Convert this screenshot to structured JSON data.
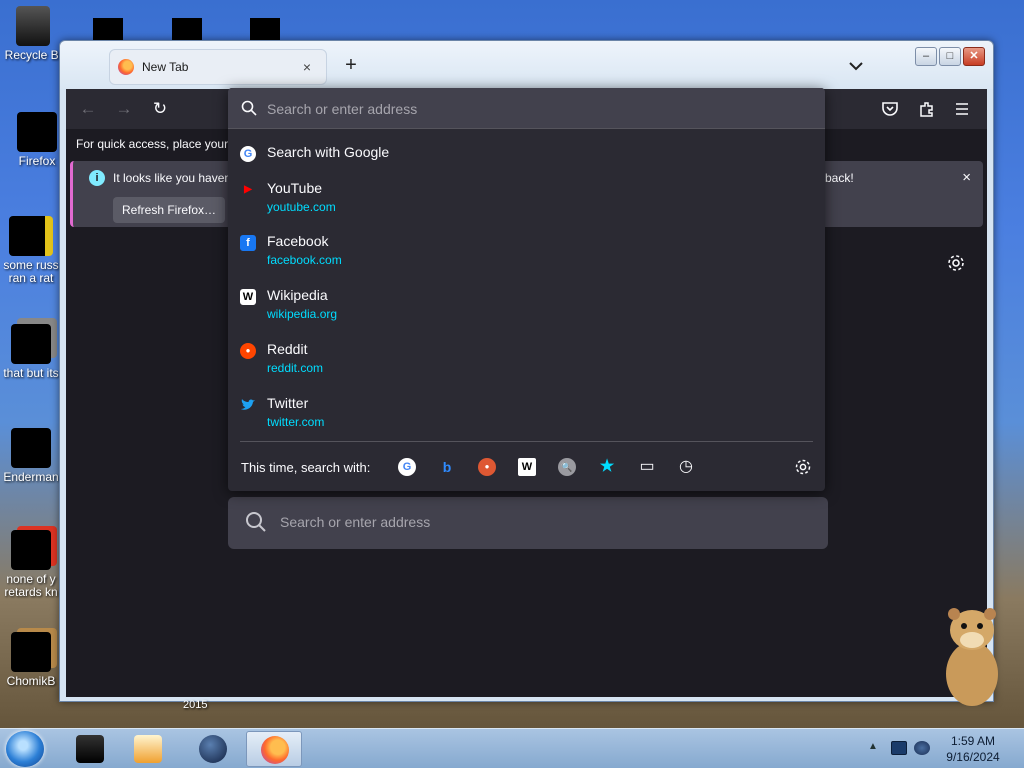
{
  "desktop": {
    "icons": [
      {
        "label": "Recycle Bi",
        "icon": "recycle-bin-icon"
      },
      {
        "label": "Firefox",
        "icon": "firefox-icon"
      },
      {
        "label": "some russ ran a rat",
        "icon": "file-icon"
      },
      {
        "label": "that but its",
        "icon": "file-icon"
      },
      {
        "label": "Enderman",
        "icon": "file-icon"
      },
      {
        "label": "none of y retards kn",
        "icon": "file-icon"
      },
      {
        "label": "ChomikB",
        "icon": "hamster-icon"
      }
    ],
    "year_label": "2015"
  },
  "browser": {
    "tab": {
      "title": "New Tab",
      "close_glyph": "×"
    },
    "new_tab_glyph": "+",
    "tab_list_glyph": "⌄",
    "window_controls": {
      "minimize": "–",
      "maximize": "□",
      "close": "✕"
    },
    "nav": {
      "back": "←",
      "forward": "→",
      "reload": "↻"
    },
    "bookmarks_hint": "For quick access, place your b",
    "notification": {
      "text_start": "It looks like you haven",
      "text_end": "back!",
      "refresh_label": "Refresh Firefox…",
      "close_glyph": "×",
      "info_glyph": "i"
    },
    "newtab_search": {
      "placeholder": "Search or enter address"
    }
  },
  "urlbar": {
    "placeholder": "Search or enter address",
    "results": [
      {
        "title": "Search with Google",
        "url": "",
        "icon": "google-icon",
        "color": "#4285f4",
        "glyph": "G"
      },
      {
        "title": "YouTube",
        "url": "youtube.com",
        "icon": "youtube-icon",
        "color": "#ff0000",
        "glyph": "▶"
      },
      {
        "title": "Facebook",
        "url": "facebook.com",
        "icon": "facebook-icon",
        "color": "#1877f2",
        "glyph": "f"
      },
      {
        "title": "Wikipedia",
        "url": "wikipedia.org",
        "icon": "wikipedia-icon",
        "color": "#ffffff",
        "glyph": "W"
      },
      {
        "title": "Reddit",
        "url": "reddit.com",
        "icon": "reddit-icon",
        "color": "#ff4500",
        "glyph": "●"
      },
      {
        "title": "Twitter",
        "url": "twitter.com",
        "icon": "twitter-icon",
        "color": "#1da1f2",
        "glyph": "🐦"
      }
    ],
    "oneoff_label": "This time, search with:",
    "oneoffs": [
      {
        "name": "google-icon",
        "glyph": "G",
        "color": "#4285f4",
        "bg": "#ffffff"
      },
      {
        "name": "bing-icon",
        "glyph": "b",
        "color": "#2f8bff",
        "bg": "transparent"
      },
      {
        "name": "duckduckgo-icon",
        "glyph": "●",
        "color": "#ffffff",
        "bg": "#de5833"
      },
      {
        "name": "wikipedia-icon",
        "glyph": "W",
        "color": "#000000",
        "bg": "#ffffff"
      },
      {
        "name": "search-engine-icon",
        "glyph": "🔍",
        "color": "#333333",
        "bg": "#9a9aa0"
      },
      {
        "name": "bookmarks-star-icon",
        "glyph": "★",
        "color": "#00ddff",
        "bg": "transparent"
      },
      {
        "name": "tabs-icon",
        "glyph": "▭",
        "color": "#fbfbfe",
        "bg": "transparent"
      },
      {
        "name": "history-icon",
        "glyph": "◷",
        "color": "#fbfbfe",
        "bg": "transparent"
      }
    ]
  },
  "taskbar": {
    "clock_time": "1:59 AM",
    "clock_date": "9/16/2024",
    "tray_arrow": "▲"
  },
  "colors": {
    "browser_bg": "#1c1b22",
    "toolbar_bg": "#2b2a33",
    "field_bg": "#42414d",
    "link_cyan": "#00ddff",
    "accent_pink": "#e16ad0"
  }
}
